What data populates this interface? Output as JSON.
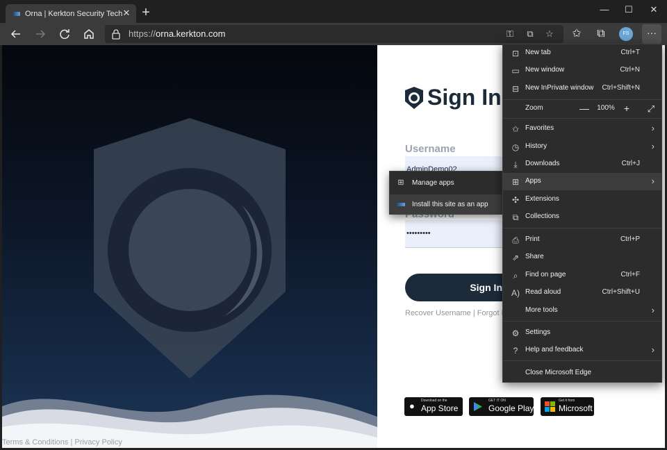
{
  "browser": {
    "tab_title": "Orna | Kerkton Security Technolo",
    "tab_close": "✕",
    "new_tab": "+",
    "window": {
      "minimize": "—",
      "maximize": "☐",
      "close": "✕"
    },
    "url_scheme": "https://",
    "url_host": "orna.kerkton.com",
    "avatar_initials": "FS",
    "menu_button": "···"
  },
  "page": {
    "heading": "Sign In",
    "username_label": "Username",
    "username_value": "AdminDemo02",
    "password_label": "Password",
    "password_value": "•••••••••",
    "signin_button": "Sign In",
    "recover_username": "Recover Username",
    "recover_sep": "|",
    "forgot_password": "Forgot P",
    "terms": "Terms & Conditions",
    "footer_sep": "|",
    "privacy": "Privacy Policy",
    "stores": [
      {
        "small": "Download on the",
        "big": "App Store"
      },
      {
        "small": "GET IT ON",
        "big": "Google Play"
      },
      {
        "small": "Get it from",
        "big": "Microsoft"
      }
    ]
  },
  "menu": {
    "items": [
      {
        "label": "New tab",
        "shortcut": "Ctrl+T",
        "icon": "new-tab-icon"
      },
      {
        "label": "New window",
        "shortcut": "Ctrl+N",
        "icon": "new-window-icon"
      },
      {
        "label": "New InPrivate window",
        "shortcut": "Ctrl+Shift+N",
        "icon": "inprivate-icon"
      },
      {
        "label": "Zoom",
        "zoom_value": "100%",
        "minus": "—",
        "plus": "+",
        "fullscreen": "⤢"
      },
      {
        "label": "Favorites",
        "icon": "favorites-icon"
      },
      {
        "label": "History",
        "icon": "history-icon"
      },
      {
        "label": "Downloads",
        "shortcut": "Ctrl+J",
        "icon": "download-icon"
      },
      {
        "label": "Apps",
        "icon": "apps-icon"
      },
      {
        "label": "Extensions",
        "icon": "extensions-icon"
      },
      {
        "label": "Collections",
        "icon": "collections-icon"
      },
      {
        "label": "Print",
        "shortcut": "Ctrl+P",
        "icon": "print-icon"
      },
      {
        "label": "Share",
        "icon": "share-icon"
      },
      {
        "label": "Find on page",
        "shortcut": "Ctrl+F",
        "icon": "find-icon"
      },
      {
        "label": "Read aloud",
        "shortcut": "Ctrl+Shift+U",
        "icon": "read-aloud-icon"
      },
      {
        "label": "More tools",
        "icon": "more-tools-icon"
      },
      {
        "label": "Settings",
        "icon": "settings-icon"
      },
      {
        "label": "Help and feedback",
        "icon": "help-icon"
      },
      {
        "label": "Close Microsoft Edge"
      }
    ]
  },
  "apps_submenu": {
    "manage": "Manage apps",
    "install": "Install this site as an app"
  },
  "colors": {
    "menu_bg": "#2c2c2c",
    "menu_active": "#3d3d3d",
    "brand_navy": "#1c2a3a",
    "field_bg": "#e9effb"
  }
}
